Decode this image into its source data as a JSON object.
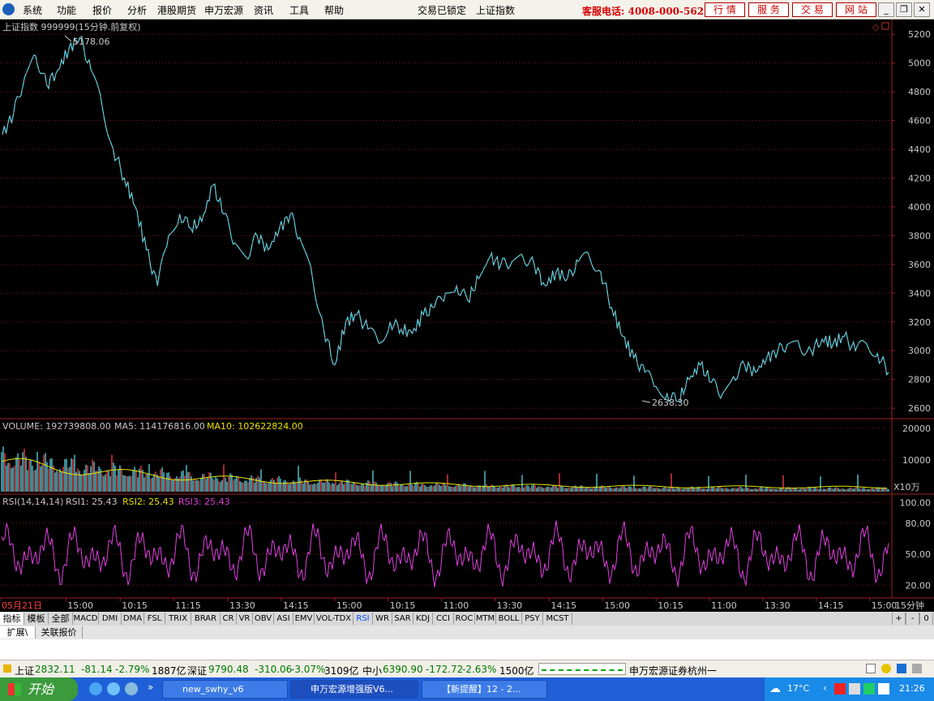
{
  "menu": [
    "系统",
    "功能",
    "报价",
    "分析",
    "港股期货",
    "申万宏源",
    "资讯",
    "工具",
    "帮助"
  ],
  "status_locked": "交易已锁定",
  "current_index": "上证指数",
  "hotline": "客服电话: 4008-000-562",
  "quick_buttons": [
    "行 情",
    "服 务",
    "交 易",
    "网 站"
  ],
  "chart_header": "上证指数 999999(15分钟.前复权)",
  "volume_header": {
    "label": "VOLUME: 192739808.00",
    "ma5": "MA5: 114176816.00",
    "ma10": "MA10: 102622824.00"
  },
  "rsi_header": {
    "label": "RSI(14,14,14)",
    "rsi1": "RSI1: 25.43",
    "rsi2": "RSI2: 25.43",
    "rsi3": "RSI3: 25.43"
  },
  "annotations": {
    "high": "5178.06",
    "low": "2638.30"
  },
  "y_unit_volume": "X10万",
  "period_label": "15分钟",
  "chart_data": [
    {
      "type": "line",
      "panel": "price",
      "title": "上证指数 999999(15分钟.前复权)",
      "y_ticks": [
        5200,
        5000,
        4800,
        4600,
        4400,
        4200,
        4000,
        3800,
        3600,
        3400,
        3200,
        3000,
        2800,
        2600
      ],
      "ylim": [
        2550,
        5280
      ],
      "x_ticks": [
        "05月21日",
        "15:00",
        "10:15",
        "11:15",
        "13:30",
        "14:15",
        "15:00",
        "10:15",
        "11:00",
        "13:30",
        "14:15",
        "15:00",
        "10:15",
        "11:00",
        "13:30",
        "14:15",
        "15:00"
      ],
      "x_tick_positions": [
        0,
        0.074,
        0.135,
        0.195,
        0.256,
        0.316,
        0.376,
        0.436,
        0.496,
        0.556,
        0.617,
        0.677,
        0.737,
        0.797,
        0.857,
        0.917,
        0.977
      ],
      "close_values": [
        4500,
        4650,
        4900,
        5050,
        4850,
        4950,
        5100,
        5178,
        4950,
        4700,
        4400,
        4200,
        4000,
        3700,
        3450,
        3800,
        3950,
        3850,
        3900,
        4150,
        3950,
        3750,
        3650,
        3800,
        3700,
        3850,
        3950,
        3750,
        3500,
        3150,
        2900,
        3200,
        3250,
        3150,
        3050,
        3200,
        3150,
        3120,
        3250,
        3300,
        3400,
        3450,
        3350,
        3500,
        3650,
        3600,
        3620,
        3650,
        3600,
        3450,
        3550,
        3500,
        3620,
        3650,
        3550,
        3300,
        3100,
        2950,
        2850,
        2750,
        2700,
        2650,
        2800,
        2900,
        2780,
        2700,
        2820,
        2900,
        2850,
        2950,
        3000,
        3050,
        3020,
        3000,
        3080,
        3050,
        3100,
        3000,
        3050,
        2980,
        2850
      ]
    },
    {
      "type": "bar",
      "panel": "volume",
      "y_ticks": [
        20000,
        10000
      ],
      "ylim": [
        0,
        22000
      ]
    },
    {
      "type": "line",
      "panel": "rsi",
      "y_ticks": [
        100.0,
        80.0,
        50.0,
        20.0
      ],
      "ylim": [
        10,
        105
      ]
    }
  ],
  "indicator_tabs": [
    "指标",
    "模板",
    "全部",
    "MACD",
    "DMI",
    "DMA",
    "FSL",
    "TRIX",
    "BRAR",
    "CR",
    "VR",
    "OBV",
    "ASI",
    "EMV",
    "VOL-TDX",
    "RSI",
    "WR",
    "SAR",
    "KDJ",
    "CCI",
    "ROC",
    "MTM",
    "BOLL",
    "PSY",
    "MCST"
  ],
  "zoom_buttons": [
    "+",
    "-",
    "0"
  ],
  "bottom_tabs": [
    "扩展\\",
    "关联报价"
  ],
  "ticker": [
    {
      "name": "上证",
      "value": "2832.11",
      "change": "-81.14",
      "pct": "-2.79%",
      "amount": "1887亿"
    },
    {
      "name": "深证",
      "value": "9790.48",
      "change": "-310.06",
      "pct": "-3.07%",
      "amount": "3109亿"
    },
    {
      "name": "中小",
      "value": "6390.90",
      "change": "-172.72",
      "pct": "-2.63%",
      "amount": "1500亿"
    }
  ],
  "broker": "申万宏源证券杭州一",
  "taskbar": {
    "start": "开始",
    "tasks": [
      "new_swhy_v6",
      "申万宏源增强版V6...",
      "【新提醒】12 - 2..."
    ],
    "weather": "17°C",
    "clock": "21:26"
  }
}
